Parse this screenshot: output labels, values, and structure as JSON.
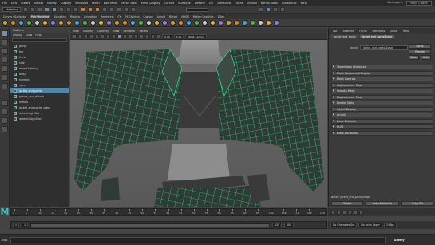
{
  "menubar": {
    "items": [
      "File",
      "Edit",
      "Create",
      "Select",
      "Modify",
      "Display",
      "Windows",
      "Mesh",
      "Edit Mesh",
      "Mesh Tools",
      "Mesh Display",
      "Curves",
      "Surfaces",
      "Deform",
      "UV",
      "Generate",
      "Cache",
      "Arnold",
      "Bonus Tools",
      "Substance",
      "Help"
    ],
    "workspace_label": "Workspace:",
    "workspace_value": "Maya Classic"
  },
  "status": {
    "mode": "Modeling"
  },
  "shelf": {
    "tabs": [
      "Curves / Surfaces",
      "Poly Modeling",
      "Sculpting",
      "Rigging",
      "Animation",
      "Rendering",
      "FX",
      "FX Caching",
      "Custom",
      "Arnold",
      "Bifrost",
      "MASH",
      "Motion Graphics",
      "XGen"
    ],
    "active": "Poly Modeling"
  },
  "outliner": {
    "title": "Outliner",
    "menus": [
      "Display",
      "Show",
      "Help"
    ],
    "items": [
      {
        "label": "persp",
        "selected": false
      },
      {
        "label": "top",
        "selected": false
      },
      {
        "label": "front",
        "selected": false
      },
      {
        "label": "side",
        "selected": false
      },
      {
        "label": "mixed:lighting",
        "selected": false
      },
      {
        "label": "body",
        "selected": false
      },
      {
        "label": "eyelash",
        "selected": false
      },
      {
        "label": "eyes",
        "selected": false
      },
      {
        "label": "jacket_and_pants",
        "selected": true
      },
      {
        "label": "gloves_and_details",
        "selected": false
      },
      {
        "label": "metals",
        "selected": false
      },
      {
        "label": "jacket_and_pants_sides",
        "selected": false
      },
      {
        "label": "defaultLightSet",
        "selected": false
      },
      {
        "label": "defaultObjectSet",
        "selected": false
      }
    ]
  },
  "viewport": {
    "menus": [
      "View",
      "Shading",
      "Lighting",
      "Show",
      "Renderer",
      "Panels"
    ],
    "exposure": "0.00",
    "gamma": "1.00",
    "colorspace": "sRGB gamma",
    "accent": "#3df0a0"
  },
  "attribute_editor": {
    "tabs": [
      "List",
      "Selected",
      "Focus",
      "Attributes",
      "Show",
      "Help"
    ],
    "node_tabs": [
      "jacket_and_pants",
      "jacket_and_pantsShape"
    ],
    "mesh_label": "mesh:",
    "mesh_value": "jacket_and_pantsShape",
    "focus_btn": "Focus",
    "presets_btn": "Presets",
    "show_btn": "Show",
    "hide_btn": "Hide",
    "sections": [
      "Tessellation Attributes",
      "Mesh Component Display",
      "Mesh Controls",
      "Displacement Map",
      "Smooth Mesh",
      "Displacement Map",
      "Render Stats",
      "Object Display",
      "Arnold",
      "Node Behavior",
      "UUID",
      "Extra Attributes"
    ],
    "notes_label": "Notes: jacket_and_pantsShape",
    "buttons": [
      "Select",
      "Load Attributes",
      "Copy Tab"
    ]
  },
  "timeline": {
    "ticks": [
      "1",
      "5",
      "10",
      "15",
      "20",
      "25",
      "30",
      "35",
      "40",
      "45",
      "50",
      "55",
      "60",
      "65",
      "70",
      "75",
      "80",
      "85",
      "90",
      "95",
      "100",
      "105",
      "110",
      "115",
      "120"
    ],
    "start": "1",
    "end": "120",
    "range_end": "200",
    "no_char_set": "No Character Set",
    "no_anim_layer": "No Anim Layer",
    "fps": "24 fps"
  },
  "cmdline": {
    "label": "MEL",
    "brand": "Udemy"
  }
}
